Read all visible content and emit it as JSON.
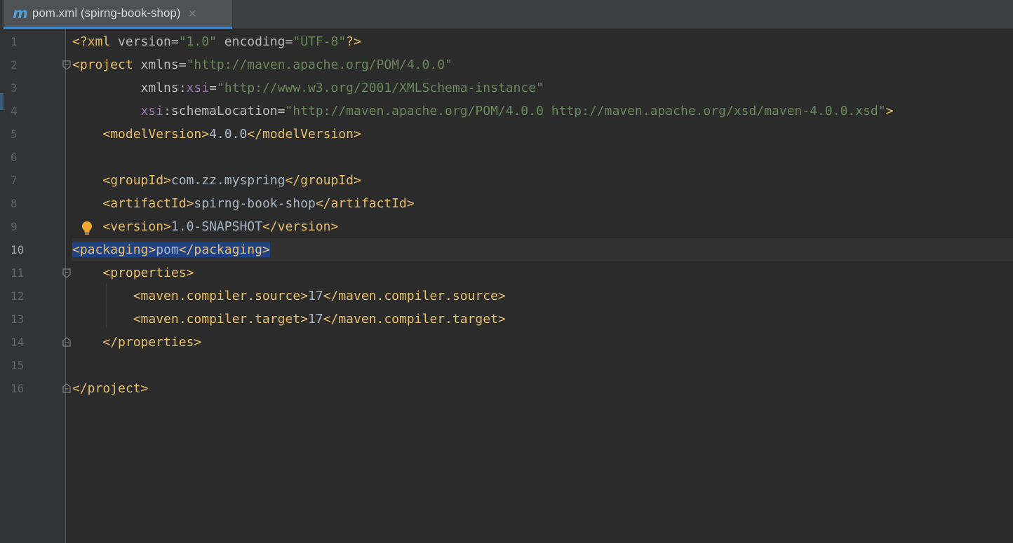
{
  "tab": {
    "icon": "m",
    "title": "pom.xml (spirng-book-shop)",
    "close_glyph": "✕"
  },
  "editor": {
    "current_line": 10,
    "lines": [
      {
        "n": "1",
        "prolog_open": "<?xml",
        "a1": "version",
        "eq1": "=",
        "v1": "\"1.0\"",
        "a2": "encoding",
        "eq2": "=",
        "v2": "\"UTF-8\"",
        "prolog_close": "?>"
      },
      {
        "n": "2",
        "open": "<project",
        "a1": "xmlns",
        "eq1": "=",
        "v1": "\"http://maven.apache.org/POM/4.0.0\""
      },
      {
        "n": "3",
        "a1": "xmlns:",
        "ns": "xsi",
        "eq1": "=",
        "v1": "\"http://www.w3.org/2001/XMLSchema-instance\""
      },
      {
        "n": "4",
        "ns": "xsi",
        "a1": ":schemaLocation",
        "eq1": "=",
        "v1": "\"http://maven.apache.org/POM/4.0.0 http://maven.apache.org/xsd/maven-4.0.0.xsd\"",
        "close": ">"
      },
      {
        "n": "5",
        "open": "<modelVersion>",
        "text": "4.0.0",
        "close": "</modelVersion>"
      },
      {
        "n": "6"
      },
      {
        "n": "7",
        "open": "<groupId>",
        "text": "com.zz.myspring",
        "close": "</groupId>"
      },
      {
        "n": "8",
        "open": "<artifactId>",
        "text": "spirng-book-shop",
        "close": "</artifactId>"
      },
      {
        "n": "9",
        "open": "<version>",
        "text": "1.0-SNAPSHOT",
        "close": "</version>"
      },
      {
        "n": "10",
        "open": "<packaging>",
        "text": "pom",
        "close": "</packaging>"
      },
      {
        "n": "11",
        "open": "<properties>"
      },
      {
        "n": "12",
        "open": "<maven.compiler.source>",
        "text": "17",
        "close": "</maven.compiler.source>"
      },
      {
        "n": "13",
        "open": "<maven.compiler.target>",
        "text": "17",
        "close": "</maven.compiler.target>"
      },
      {
        "n": "14",
        "close": "</properties>"
      },
      {
        "n": "15"
      },
      {
        "n": "16",
        "close": "</project>"
      }
    ]
  },
  "colors": {
    "tag": "#e8bf6a",
    "attribute": "#bababa",
    "namespace": "#9876aa",
    "string": "#6a8759",
    "text": "#a9b7c6",
    "selection": "#214283",
    "background": "#2b2b2b",
    "gutter": "#313335",
    "tab_underline": "#4a88c7"
  }
}
